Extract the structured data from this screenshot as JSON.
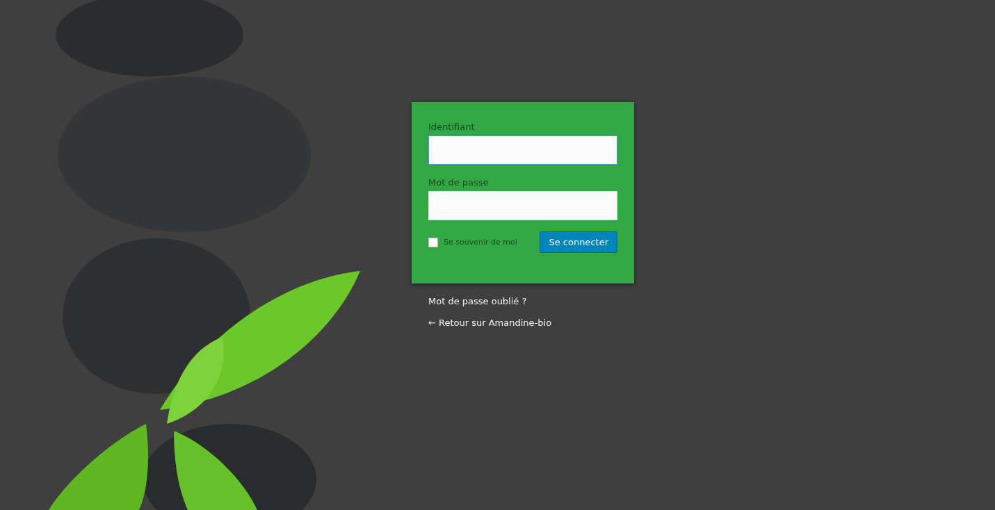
{
  "login_form": {
    "username": {
      "label": "Identifiant",
      "focused": true
    },
    "password": {
      "label": "Mot de passe"
    },
    "remember_me": {
      "label": "Se souvenir de moi",
      "checked": false
    },
    "submit": "Se connecter"
  },
  "links": [
    "Mot de passe oublié ?",
    "← Retour sur Amandine-bio"
  ]
}
